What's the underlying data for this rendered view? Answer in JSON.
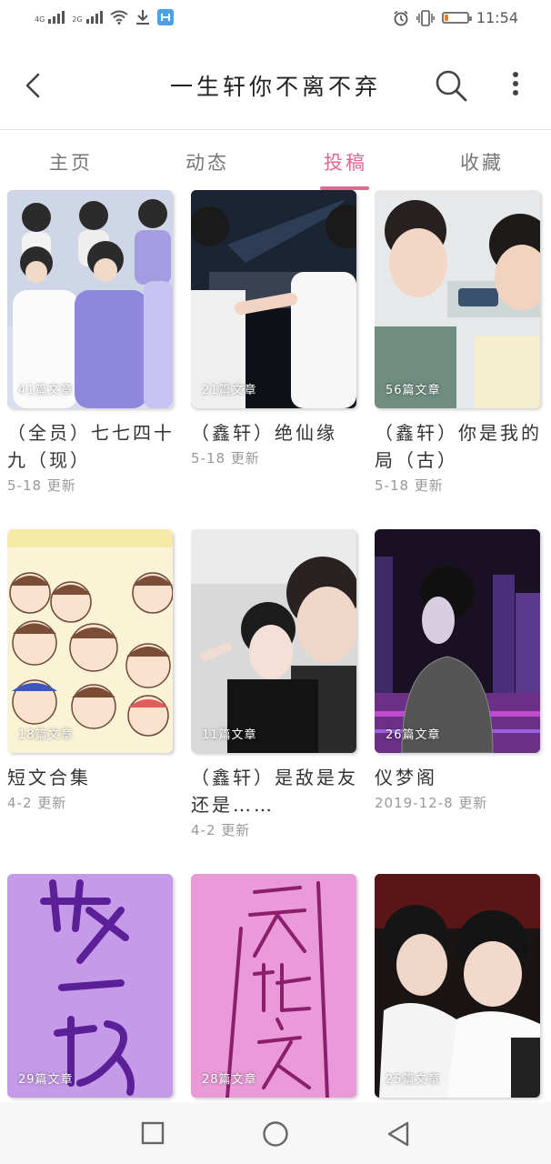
{
  "status_bar": {
    "network_1": "4G",
    "network_2": "2G",
    "time": "11:54",
    "battery_level": 0.15,
    "battery_color": "#ff7a00"
  },
  "header": {
    "title": "一生轩你不离不弃",
    "back_icon": "back-arrow-icon",
    "search_icon": "search-icon",
    "more_icon": "more-vertical-icon"
  },
  "tabs": [
    {
      "label": "主页"
    },
    {
      "label": "动态"
    },
    {
      "label": "投稿"
    },
    {
      "label": "收藏"
    }
  ],
  "active_tab": "投稿",
  "accent_color": "#e6658f",
  "cards": [
    {
      "count": "41篇文章",
      "title": "（全员）七七四十九（现）",
      "date": "5-18 更新"
    },
    {
      "count": "21篇文章",
      "title": "（鑫轩）绝仙缘",
      "date": "5-18 更新"
    },
    {
      "count": "56篇文章",
      "title": "（鑫轩）你是我的局（古）",
      "date": "5-18 更新"
    },
    {
      "count": "18篇文章",
      "title": "短文合集",
      "date": "4-2 更新"
    },
    {
      "count": "11篇文章",
      "title": "（鑫轩）是敌是友还是……",
      "date": "4-2 更新"
    },
    {
      "count": "26篇文章",
      "title": "仪梦阁",
      "date": "2019-12-8 更新"
    },
    {
      "count": "29篇文章",
      "title": "",
      "date": ""
    },
    {
      "count": "28篇文章",
      "title": "",
      "date": ""
    },
    {
      "count": "25篇文章",
      "title": "",
      "date": ""
    }
  ],
  "cover_lettering": {
    "card_7": "梦一场",
    "card_8": "天地之恋"
  },
  "nav": {
    "recents_icon": "square-icon",
    "home_icon": "circle-icon",
    "back_icon": "triangle-back-icon"
  }
}
